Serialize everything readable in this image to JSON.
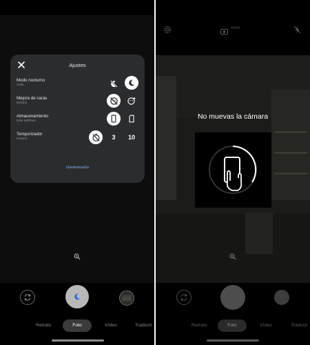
{
  "left_screen": {
    "settings": {
      "title": "Ajustes",
      "rows": [
        {
          "label": "Modo nocturno",
          "status": "Activ.",
          "options": [
            "moon-off-icon",
            "moon-icon"
          ],
          "selected": 1
        },
        {
          "label": "Mejora de caras",
          "status": "Desact.",
          "options": [
            "face-retouch-off-icon",
            "face-retouch-icon"
          ],
          "selected": 0
        },
        {
          "label": "Almacenamiento",
          "status": "Este teléfono",
          "options": [
            "phone-icon",
            "sd-card-icon"
          ],
          "selected": 0
        },
        {
          "label": "Temporizador",
          "status": "Desact.",
          "options": [
            "timer-off-icon",
            "3",
            "10"
          ],
          "selected": 0
        }
      ],
      "footer": "GreatnessGo"
    },
    "modes": [
      "Retrato",
      "Foto",
      "Vídeo",
      "Traducir"
    ],
    "active_mode": "Foto"
  },
  "right_screen": {
    "top_label": "more",
    "message": "No muevas la cámara",
    "modes": [
      "Retrato",
      "Foto",
      "Vídeo",
      "Traducir"
    ],
    "active_mode": "Foto"
  },
  "colors": {
    "panel_bg": "#2b2c2e",
    "accent_link": "#8ab4f8"
  }
}
